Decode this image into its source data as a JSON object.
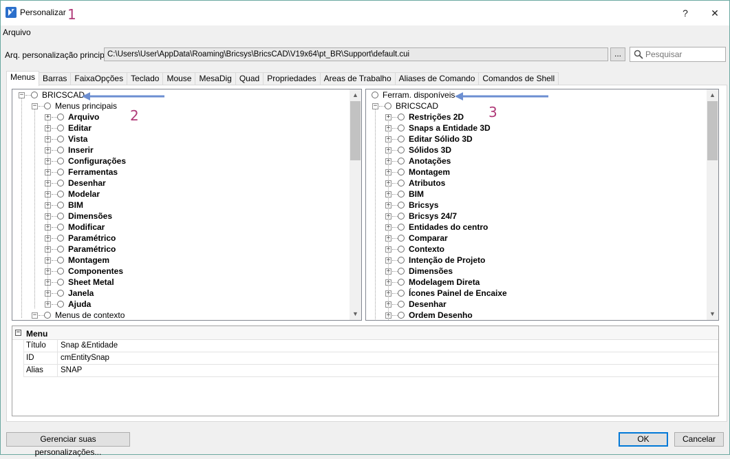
{
  "window": {
    "title": "Personalizar",
    "help": "?",
    "close": "✕"
  },
  "annotations": {
    "a1": "1",
    "a2": "2",
    "a3": "3"
  },
  "menubar": {
    "file": "Arquivo"
  },
  "path": {
    "label": "Arq. personalização principal:",
    "value": "C:\\Users\\User\\AppData\\Roaming\\Bricsys\\BricsCAD\\V19x64\\pt_BR\\Support\\default.cui",
    "browse": "...",
    "search_placeholder": "Pesquisar"
  },
  "tabs": [
    "Menus",
    "Barras",
    "FaixaOpções",
    "Teclado",
    "Mouse",
    "MesaDig",
    "Quad",
    "Propriedades",
    "Areas de Trabalho",
    "Aliases de Comando",
    "Comandos de Shell"
  ],
  "left_tree": {
    "root": "BRICSCAD",
    "main_menus": "Menus principais",
    "items": [
      "Arquivo",
      "Editar",
      "Vista",
      "Inserir",
      "Configurações",
      "Ferramentas",
      "Desenhar",
      "Modelar",
      "BIM",
      "Dimensões",
      "Modificar",
      "Paramétrico",
      "Paramétrico",
      "Montagem",
      "Componentes",
      "Sheet Metal",
      "Janela",
      "Ajuda"
    ],
    "context_menus": "Menus de contexto"
  },
  "right_tree": {
    "root": "Ferram. disponíveis",
    "group": "BRICSCAD",
    "items": [
      "Restrições 2D",
      "Snaps a Entidade 3D",
      "Editar Sólido 3D",
      "Sólidos 3D",
      "Anotações",
      "Montagem",
      "Atributos",
      "BIM",
      "Bricsys",
      "Bricsys 24/7",
      "Entidades do centro",
      "Comparar",
      "Contexto",
      "Intenção de Projeto",
      "Dimensões",
      "Modelagem Direta",
      "Ícones Painel de Encaixe",
      "Desenhar",
      "Ordem Desenho"
    ]
  },
  "properties": {
    "category": "Menu",
    "rows": [
      {
        "key": "Título",
        "value": "Snap &Entidade"
      },
      {
        "key": "ID",
        "value": "cmEntitySnap"
      },
      {
        "key": "Alias",
        "value": "SNAP"
      }
    ]
  },
  "buttons": {
    "manage": "Gerenciar suas personalizações...",
    "ok": "OK",
    "cancel": "Cancelar"
  },
  "colors": {
    "accent": "#0078d7",
    "annotation": "#b03a78",
    "arrow": "#6d8fd1"
  }
}
